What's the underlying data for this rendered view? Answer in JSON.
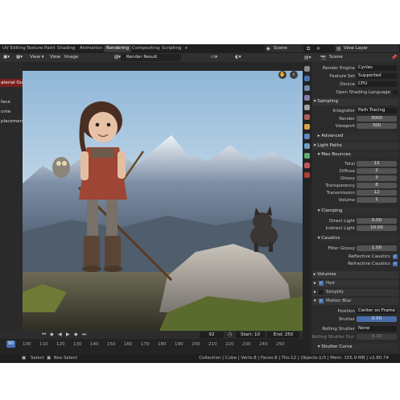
{
  "workspace_tabs": [
    "UV Editing",
    "Texture Paint",
    "Shading",
    "Animation",
    "Rendering",
    "Compositing",
    "Scripting",
    "+"
  ],
  "active_tab": "Rendering",
  "scene_name": "Scene",
  "view_layer": "View Layer",
  "image_editor": {
    "menu_view": "View",
    "menu_view2": "View",
    "menu_image": "Image",
    "render_slot": "Render Result"
  },
  "left_panel": {
    "material_output": "aterial Out",
    "items": [
      "face",
      "ume",
      "placement"
    ]
  },
  "properties": {
    "header_scene": "Scene",
    "render_engine_label": "Render Engine",
    "render_engine": "Cycles",
    "feature_set_label": "Feature Set",
    "feature_set": "Supported",
    "device_label": "Device",
    "device": "CPU",
    "osl_label": "Open Shading Language",
    "sampling_title": "Sampling",
    "integrator_label": "Integrator",
    "integrator": "Path Tracing",
    "render_label": "Render",
    "render_samples": "3000",
    "viewport_label": "Viewport",
    "viewport_samples": "300",
    "advanced_title": "Advanced",
    "light_paths_title": "Light Paths",
    "max_bounces_title": "Max Bounces",
    "bounces": [
      {
        "label": "Total",
        "value": "12"
      },
      {
        "label": "Diffuse",
        "value": "2"
      },
      {
        "label": "Glossy",
        "value": "3"
      },
      {
        "label": "Transparency",
        "value": "8"
      },
      {
        "label": "Transmission",
        "value": "12"
      },
      {
        "label": "Volume",
        "value": "1"
      }
    ],
    "clamping_title": "Clamping",
    "direct_light_label": "Direct Light",
    "direct_light": "0.00",
    "indirect_light_label": "Indirect Light",
    "indirect_light": "10.00",
    "caustics_title": "Caustics",
    "filter_glossy_label": "Filter Glossy",
    "filter_glossy": "1.00",
    "reflective_caustics": "Reflective Caustics",
    "refractive_caustics": "Refractive Caustics",
    "volumes_title": "Volumes",
    "hair_label": "Hair",
    "simplify_label": "Simplify",
    "motion_blur_label": "Motion Blur",
    "position_label": "Position",
    "position": "Center on Frame",
    "shutter_label": "Shutter",
    "shutter": "0.50",
    "rolling_shutter_label": "Rolling Shutter",
    "rolling_shutter": "None",
    "rolling_shutter_dur_label": "Rolling Shutter Dur.",
    "rolling_shutter_dur": "0.10",
    "shutter_curve_title": "Shutter Curve"
  },
  "timeline": {
    "current_frame": "92",
    "start_label": "Start:",
    "start": "10",
    "end_label": "End:",
    "end": "250",
    "ruler_current": "90",
    "ticks": [
      "100",
      "110",
      "120",
      "130",
      "140",
      "150",
      "160",
      "170",
      "180",
      "190",
      "200",
      "210",
      "220",
      "230",
      "240",
      "250"
    ]
  },
  "statusbar": {
    "select": "Select",
    "box_select": "Box Select",
    "stats": "Collection | Cube | Verts:8 | Faces:6 | Tris:12 | Objects:1/3 | Mem: 155.9 MB | v2.80.74"
  },
  "colors": {
    "active_blue": "#4772b3",
    "material_output_red": "#7a1f1f",
    "slider_blue": "#4a6ea9"
  }
}
